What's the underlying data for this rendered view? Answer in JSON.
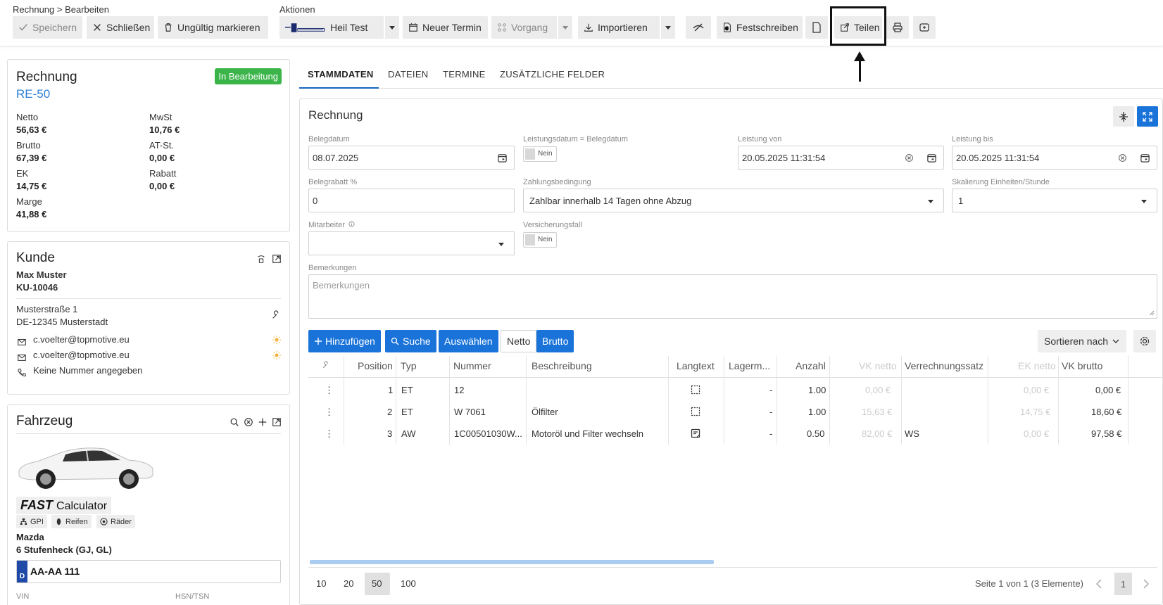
{
  "breadcrumb": "Rechnung > Bearbeiten",
  "toolbar": {
    "actions_label": "Aktionen",
    "save": "Speichern",
    "close": "Schließen",
    "invalidate": "Ungültig markieren",
    "heil_test": "Heil Test",
    "new_appointment": "Neuer Termin",
    "process": "Vorgang",
    "import": "Importieren",
    "commit": "Festschreiben",
    "share": "Teilen"
  },
  "summary": {
    "title": "Rechnung",
    "status": "In Bearbeitung",
    "number": "RE-50",
    "netto_label": "Netto",
    "netto": "56,63 €",
    "mwst_label": "MwSt",
    "mwst": "10,76 €",
    "brutto_label": "Brutto",
    "brutto": "67,39 €",
    "atst_label": "AT-St.",
    "atst": "0,00 €",
    "ek_label": "EK",
    "ek": "14,75 €",
    "rabatt_label": "Rabatt",
    "rabatt": "0,00 €",
    "marge_label": "Marge",
    "marge": "41,88 €"
  },
  "customer": {
    "title": "Kunde",
    "name": "Max Muster",
    "number": "KU-10046",
    "street": "Musterstraße 1",
    "city": "DE-12345 Musterstadt",
    "email1": "c.voelter@topmotive.eu",
    "email2": "c.voelter@topmotive.eu",
    "phone": "Keine Nummer angegeben"
  },
  "vehicle": {
    "title": "Fahrzeug",
    "brand_fast": "FAST",
    "brand_calc": "Calculator",
    "chip_gpi": "GPI",
    "chip_tires": "Reifen",
    "chip_wheels": "Räder",
    "make": "Mazda",
    "model": "6 Stufenheck (GJ, GL)",
    "plate_country": "D",
    "plate": "AA-AA 111",
    "vin_label": "VIN",
    "hsn_label": "HSN/TSN"
  },
  "tabs": [
    "STAMMDATEN",
    "DATEIEN",
    "TERMINE",
    "ZUSÄTZLICHE FELDER"
  ],
  "form": {
    "title": "Rechnung",
    "belegdatum_label": "Belegdatum",
    "belegdatum": "08.07.2025",
    "leistungsdatum_label": "Leistungsdatum = Belegdatum",
    "leistungsdatum_toggle": "Nein",
    "leistung_von_label": "Leistung von",
    "leistung_von": "20.05.2025 11:31:54",
    "leistung_bis_label": "Leistung bis",
    "leistung_bis": "20.05.2025 11:31:54",
    "belegrabatt_label": "Belegrabatt %",
    "belegrabatt": "0",
    "zahlung_label": "Zahlungsbedingung",
    "zahlung": "Zahlbar innerhalb 14 Tagen ohne Abzug",
    "skalierung_label": "Skalierung Einheiten/Stunde",
    "skalierung": "1",
    "mitarbeiter_label": "Mitarbeiter",
    "versicherung_label": "Versicherungsfall",
    "versicherung_toggle": "Nein",
    "bemerkungen_label": "Bemerkungen",
    "bemerkungen_placeholder": "Bemerkungen"
  },
  "list_toolbar": {
    "add": "Hinzufügen",
    "search": "Suche",
    "select": "Auswählen",
    "netto": "Netto",
    "brutto": "Brutto",
    "sort": "Sortieren nach"
  },
  "table": {
    "headers": {
      "position": "Position",
      "typ": "Typ",
      "nummer": "Nummer",
      "beschreibung": "Beschreibung",
      "langtext": "Langtext",
      "lager": "Lagerm...",
      "anzahl": "Anzahl",
      "vknetto": "VK netto",
      "verrechnung": "Verrechnungssatz",
      "eknetto": "EK netto",
      "vkbrutto": "VK brutto"
    },
    "rows": [
      {
        "position": "1",
        "typ": "ET",
        "nummer": "12",
        "beschreibung": "",
        "lager": "-",
        "anzahl": "1.00",
        "vknetto": "0,00 €",
        "verrechnung": "",
        "eknetto": "0,00 €",
        "vkbrutto": "0,00 €"
      },
      {
        "position": "2",
        "typ": "ET",
        "nummer": "W 7061",
        "beschreibung": "Ölfilter",
        "lager": "-",
        "anzahl": "1.00",
        "vknetto": "15,63 €",
        "verrechnung": "",
        "eknetto": "14,75 €",
        "vkbrutto": "18,60 €"
      },
      {
        "position": "3",
        "typ": "AW",
        "nummer": "1C00501030W...",
        "beschreibung": "Motoröl und Filter wechseln",
        "lager": "-",
        "anzahl": "0.50",
        "vknetto": "82,00 €",
        "verrechnung": "WS",
        "eknetto": "0,00 €",
        "vkbrutto": "97,58 €"
      }
    ]
  },
  "pagination": {
    "sizes": [
      "10",
      "20",
      "50",
      "100"
    ],
    "info": "Seite 1 von 1 (3 Elemente)",
    "current": "1"
  },
  "colors": {
    "accent": "#1a73d9",
    "status": "#3bb54a",
    "link": "#2b7fd6"
  }
}
